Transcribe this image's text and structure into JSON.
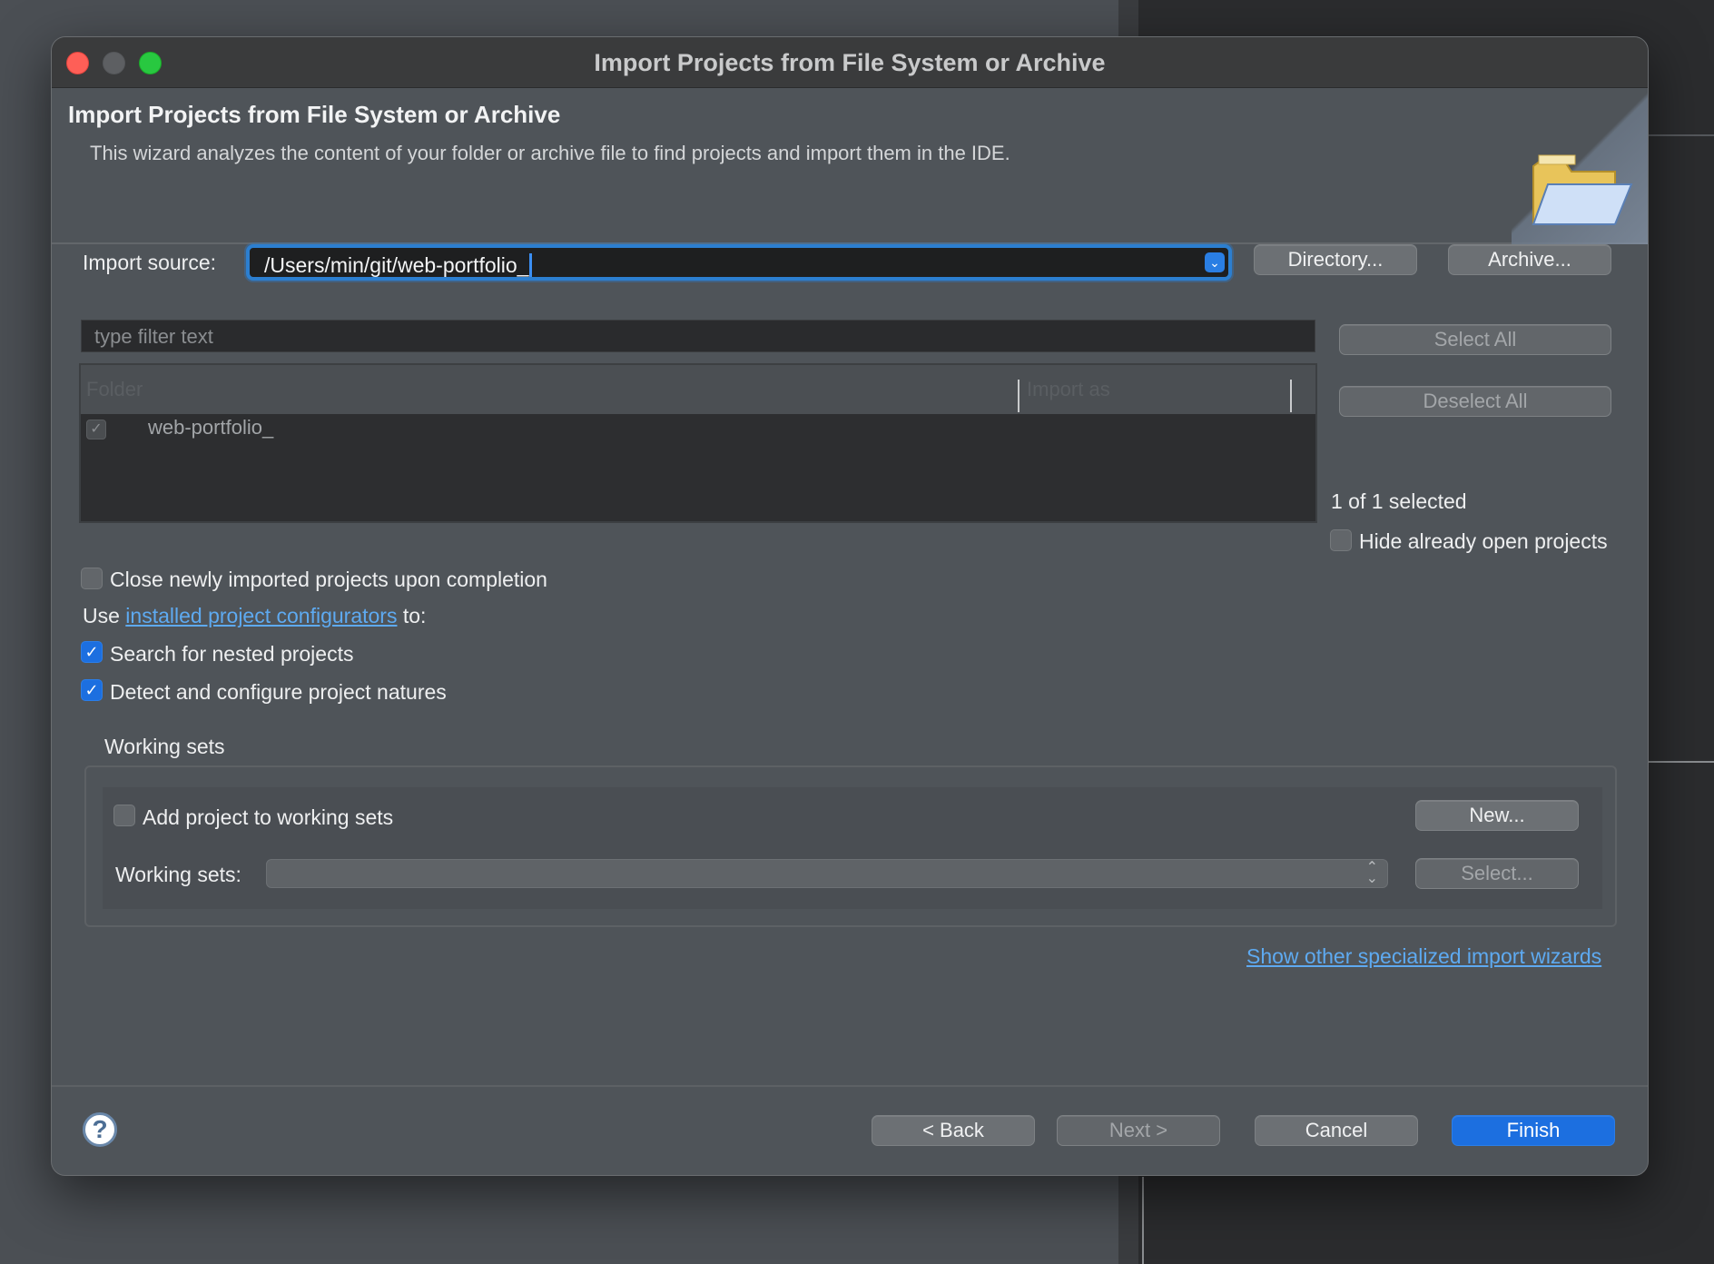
{
  "window": {
    "title": "Import Projects from File System or Archive"
  },
  "header": {
    "title": "Import Projects from File System or Archive",
    "description": "This wizard analyzes the content of your folder or archive file to find projects and import them in the IDE."
  },
  "import_source": {
    "label": "Import source:",
    "value": "/Users/min/git/web-portfolio_",
    "directory_button": "Directory...",
    "archive_button": "Archive..."
  },
  "filter": {
    "placeholder": "type filter text"
  },
  "table": {
    "columns": [
      "Folder",
      "Import as"
    ],
    "rows": [
      {
        "folder": "web-portfolio_",
        "import_as": "",
        "checked": true
      }
    ]
  },
  "selection": {
    "select_all": "Select All",
    "deselect_all": "Deselect All",
    "count": "1 of 1 selected",
    "hide_open_label": "Hide already open projects"
  },
  "options": {
    "close_after": "Close newly imported projects upon completion",
    "use_prefix": "Use",
    "configurators_link": "installed project configurators",
    "use_suffix": "to:",
    "search_nested": "Search for nested projects",
    "detect_natures": "Detect and configure project natures"
  },
  "working_sets": {
    "group_title": "Working sets",
    "add_label": "Add project to working sets",
    "new_button": "New...",
    "field_label": "Working sets:",
    "select_button": "Select..."
  },
  "other_wizards_link": "Show other specialized import wizards",
  "footer": {
    "back": "< Back",
    "next": "Next >",
    "cancel": "Cancel",
    "finish": "Finish"
  },
  "colors": {
    "accent": "#1c6fe0",
    "link": "#5eaaf1",
    "focus_ring": "#2c7fd0"
  }
}
